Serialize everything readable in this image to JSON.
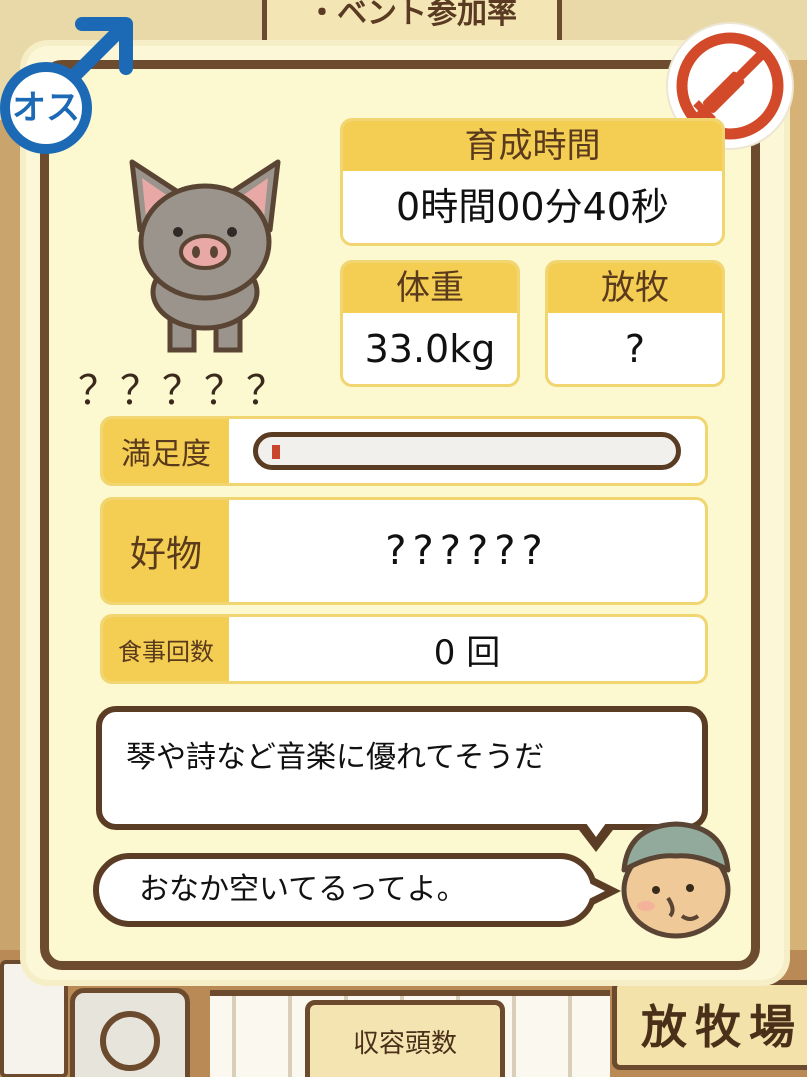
{
  "background": {
    "top_sign_text": "・ベント参加率",
    "capacity_label": "収容頭数",
    "field_sign_text": "放牧場"
  },
  "badges": {
    "gender_label": "オス",
    "gender_icon": "male-symbol-icon",
    "injection_icon": "no-injection-icon",
    "gender_color": "#1c69b5",
    "injection_color": "#d24a2a"
  },
  "pig": {
    "name": "？？？？？",
    "icon": "pig-icon"
  },
  "stats": {
    "time_label": "育成時間",
    "time_value": "0時間00分40秒",
    "weight_label": "体重",
    "weight_value": "33.0kg",
    "graze_label": "放牧",
    "graze_value": "?",
    "satisfaction_label": "満足度",
    "satisfaction_fraction": 0.02,
    "favorite_label": "好物",
    "favorite_value": "??????",
    "meals_label": "食事回数",
    "meals_value": "0 回"
  },
  "dialogue": {
    "comment": "琴や詩など音楽に優れてそうだ",
    "farmer_line": "おなか空いてるってよ。",
    "farmer_icon": "farmer-face-icon"
  },
  "colors": {
    "label_bg": "#f4cd53",
    "frame": "#6d4b2f",
    "panel_bg": "#fcf8cf",
    "bar_fill": "#c9452c"
  }
}
